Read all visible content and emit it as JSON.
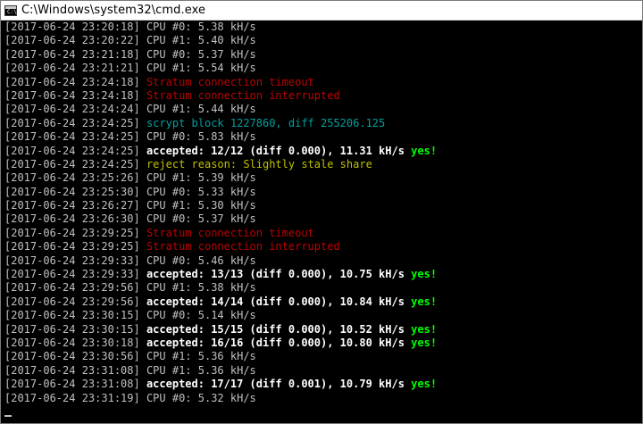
{
  "window": {
    "title": "C:\\Windows\\system32\\cmd.exe",
    "icon": "cmd-icon",
    "icon_glyph": "C:\\"
  },
  "colors": {
    "default": "#c0c0c0",
    "bright": "#ffffff",
    "error": "#c00000",
    "block": "#00a0a0",
    "warning": "#c0c000",
    "success": "#00ff00"
  },
  "console": {
    "lines": [
      {
        "ts": "[2017-06-24 23:20:18]",
        "segments": [
          {
            "text": " CPU #0: 5.38 kH/s",
            "style": "gray"
          }
        ]
      },
      {
        "ts": "[2017-06-24 23:20:22]",
        "segments": [
          {
            "text": " CPU #1: 5.40 kH/s",
            "style": "gray"
          }
        ]
      },
      {
        "ts": "[2017-06-24 23:21:18]",
        "segments": [
          {
            "text": " CPU #0: 5.37 kH/s",
            "style": "gray"
          }
        ]
      },
      {
        "ts": "[2017-06-24 23:21:21]",
        "segments": [
          {
            "text": " CPU #1: 5.54 kH/s",
            "style": "gray"
          }
        ]
      },
      {
        "ts": "[2017-06-24 23:24:18]",
        "segments": [
          {
            "text": " Stratum connection timeout",
            "style": "red"
          }
        ]
      },
      {
        "ts": "[2017-06-24 23:24:18]",
        "segments": [
          {
            "text": " Stratum connection interrupted",
            "style": "red"
          }
        ]
      },
      {
        "ts": "[2017-06-24 23:24:24]",
        "segments": [
          {
            "text": " CPU #1: 5.44 kH/s",
            "style": "gray"
          }
        ]
      },
      {
        "ts": "[2017-06-24 23:24:25]",
        "segments": [
          {
            "text": " scrypt block 1227860, diff 255206.125",
            "style": "cyan"
          }
        ]
      },
      {
        "ts": "[2017-06-24 23:24:25]",
        "segments": [
          {
            "text": " CPU #0: 5.83 kH/s",
            "style": "gray"
          }
        ]
      },
      {
        "ts": "[2017-06-24 23:24:25]",
        "segments": [
          {
            "text": " accepted: 12/12 (diff 0.000), 11.31 kH/s ",
            "style": "white"
          },
          {
            "text": "yes!",
            "style": "green"
          }
        ]
      },
      {
        "ts": "[2017-06-24 23:24:25]",
        "segments": [
          {
            "text": " reject reason: Slightly stale share",
            "style": "yellow"
          }
        ]
      },
      {
        "ts": "[2017-06-24 23:25:26]",
        "segments": [
          {
            "text": " CPU #1: 5.39 kH/s",
            "style": "gray"
          }
        ]
      },
      {
        "ts": "[2017-06-24 23:25:30]",
        "segments": [
          {
            "text": " CPU #0: 5.33 kH/s",
            "style": "gray"
          }
        ]
      },
      {
        "ts": "[2017-06-24 23:26:27]",
        "segments": [
          {
            "text": " CPU #1: 5.30 kH/s",
            "style": "gray"
          }
        ]
      },
      {
        "ts": "[2017-06-24 23:26:30]",
        "segments": [
          {
            "text": " CPU #0: 5.37 kH/s",
            "style": "gray"
          }
        ]
      },
      {
        "ts": "[2017-06-24 23:29:25]",
        "segments": [
          {
            "text": " Stratum connection timeout",
            "style": "red"
          }
        ]
      },
      {
        "ts": "[2017-06-24 23:29:25]",
        "segments": [
          {
            "text": " Stratum connection interrupted",
            "style": "red"
          }
        ]
      },
      {
        "ts": "[2017-06-24 23:29:33]",
        "segments": [
          {
            "text": " CPU #0: 5.46 kH/s",
            "style": "gray"
          }
        ]
      },
      {
        "ts": "[2017-06-24 23:29:33]",
        "segments": [
          {
            "text": " accepted: 13/13 (diff 0.000), 10.75 kH/s ",
            "style": "white"
          },
          {
            "text": "yes!",
            "style": "green"
          }
        ]
      },
      {
        "ts": "[2017-06-24 23:29:56]",
        "segments": [
          {
            "text": " CPU #1: 5.38 kH/s",
            "style": "gray"
          }
        ]
      },
      {
        "ts": "[2017-06-24 23:29:56]",
        "segments": [
          {
            "text": " accepted: 14/14 (diff 0.000), 10.84 kH/s ",
            "style": "white"
          },
          {
            "text": "yes!",
            "style": "green"
          }
        ]
      },
      {
        "ts": "[2017-06-24 23:30:15]",
        "segments": [
          {
            "text": " CPU #0: 5.14 kH/s",
            "style": "gray"
          }
        ]
      },
      {
        "ts": "[2017-06-24 23:30:15]",
        "segments": [
          {
            "text": " accepted: 15/15 (diff 0.000), 10.52 kH/s ",
            "style": "white"
          },
          {
            "text": "yes!",
            "style": "green"
          }
        ]
      },
      {
        "ts": "[2017-06-24 23:30:18]",
        "segments": [
          {
            "text": " accepted: 16/16 (diff 0.000), 10.80 kH/s ",
            "style": "white"
          },
          {
            "text": "yes!",
            "style": "green"
          }
        ]
      },
      {
        "ts": "[2017-06-24 23:30:56]",
        "segments": [
          {
            "text": " CPU #1: 5.36 kH/s",
            "style": "gray"
          }
        ]
      },
      {
        "ts": "[2017-06-24 23:31:08]",
        "segments": [
          {
            "text": " CPU #1: 5.36 kH/s",
            "style": "gray"
          }
        ]
      },
      {
        "ts": "[2017-06-24 23:31:08]",
        "segments": [
          {
            "text": " accepted: 17/17 (diff 0.001), 10.79 kH/s ",
            "style": "white"
          },
          {
            "text": "yes!",
            "style": "green"
          }
        ]
      },
      {
        "ts": "[2017-06-24 23:31:19]",
        "segments": [
          {
            "text": " CPU #0: 5.32 kH/s",
            "style": "gray"
          }
        ]
      }
    ]
  }
}
